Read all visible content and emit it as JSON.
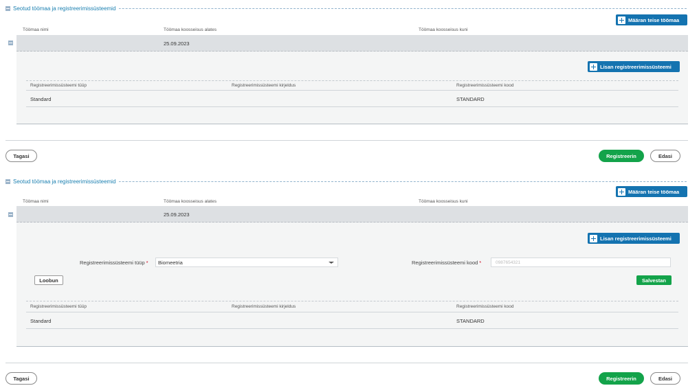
{
  "panel1": {
    "section_title": "Seotud töömaa ja registreerimissüsteemid",
    "assign_button_label": "Määran teise töömaa",
    "columns": [
      "Töömaa nimi",
      "Töömaa koosseisus alates",
      "Töömaa koosseisus kuni"
    ],
    "row": {
      "name": "",
      "from": "25.09.2023",
      "until": ""
    },
    "add_system_button_label": "Lisan registreerimissüsteemi",
    "sub_columns": [
      "Registreerimissüsteemi tüüp",
      "Registreerimissüsteemi kirjeldus",
      "Registreerimissüsteemi kood"
    ],
    "sub_rows": [
      {
        "type": "Standard",
        "description": "",
        "code": "STANDARD"
      }
    ],
    "back_label": "Tagasi",
    "register_label": "Registreerin",
    "next_label": "Edasi"
  },
  "panel2": {
    "section_title": "Seotud töömaa ja registreerimissüsteemid",
    "assign_button_label": "Määran teise töömaa",
    "columns": [
      "Töömaa nimi",
      "Töömaa koosseisus alates",
      "Töömaa koosseisus kuni"
    ],
    "row": {
      "name": "",
      "from": "25.09.2023",
      "until": ""
    },
    "add_system_button_label": "Lisan registreerimissüsteemi",
    "form": {
      "type_label": "Registreerimissüsteemi tüüp",
      "type_value": "Biomeetria",
      "code_label": "Registreerimissüsteemi kood",
      "code_value": "0987654321",
      "required_mark": "*",
      "cancel_label": "Loobun",
      "save_label": "Salvestan"
    },
    "sub_columns": [
      "Registreerimissüsteemi tüüp",
      "Registreerimissüsteemi kirjeldus",
      "Registreerimissüsteemi kood"
    ],
    "sub_rows": [
      {
        "type": "Standard",
        "description": "",
        "code": "STANDARD"
      }
    ],
    "back_label": "Tagasi",
    "register_label": "Registreerin",
    "next_label": "Edasi"
  },
  "colors": {
    "accent_blue": "#1473b0",
    "success_green": "#13a34a",
    "link_title": "#1a7fb0",
    "required_red": "#d0021b"
  },
  "icons": [
    "collapse-icon",
    "plus-icon",
    "chevron-down-icon"
  ]
}
